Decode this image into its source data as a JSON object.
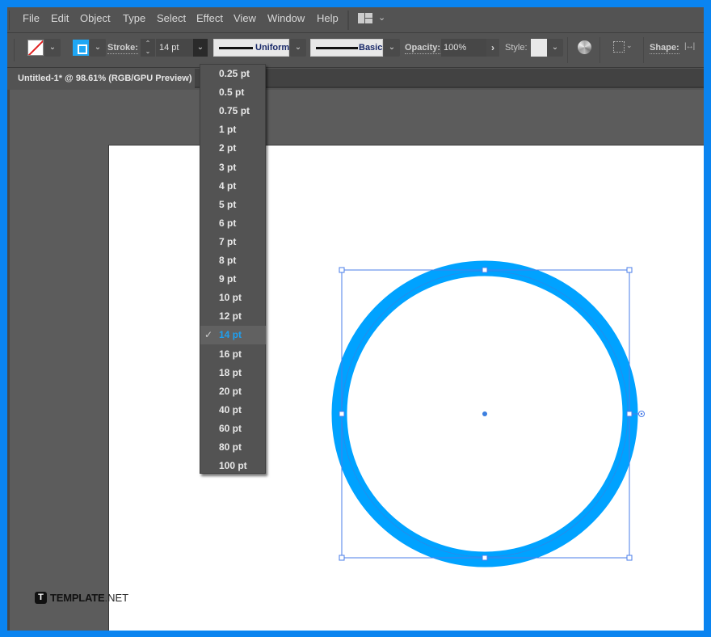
{
  "menubar": {
    "items": [
      "File",
      "Edit",
      "Object",
      "Type",
      "Select",
      "Effect",
      "View",
      "Window",
      "Help"
    ]
  },
  "controlbar": {
    "fill_swatch": "none",
    "stroke_swatch_color": "#1ea7f5",
    "stroke_label": "Stroke:",
    "stroke_value": "14 pt",
    "variable_width_profile": "Uniform",
    "brush_definition": "Basic",
    "opacity_label": "Opacity:",
    "opacity_value": "100%",
    "style_label": "Style:",
    "shape_label": "Shape:",
    "icons": [
      "recolor-artwork-icon",
      "align-icon",
      "shape-width-icon",
      "workspace-switcher-icon"
    ]
  },
  "document_tab": {
    "title": "Untitled-1* @ 98.61% (RGB/GPU Preview)"
  },
  "stroke_menu": {
    "options": [
      "0.25 pt",
      "0.5 pt",
      "0.75 pt",
      "1 pt",
      "2 pt",
      "3 pt",
      "4 pt",
      "5 pt",
      "6 pt",
      "7 pt",
      "8 pt",
      "9 pt",
      "10 pt",
      "12 pt",
      "14 pt",
      "16 pt",
      "18 pt",
      "20 pt",
      "40 pt",
      "60 pt",
      "80 pt",
      "100 pt"
    ],
    "selected": "14 pt",
    "check_glyph": "✓"
  },
  "artwork": {
    "shape": "circle",
    "stroke_color": "#00a2ff",
    "fill_color": "#ffffff",
    "selection_color": "#4a7de8"
  },
  "watermark": {
    "logo": "T",
    "brand": "TEMPLATE",
    "suffix": ".NET"
  },
  "colors": {
    "frame": "#0a84f0",
    "ui_bg": "#535353",
    "accent": "#1e9ff0"
  }
}
